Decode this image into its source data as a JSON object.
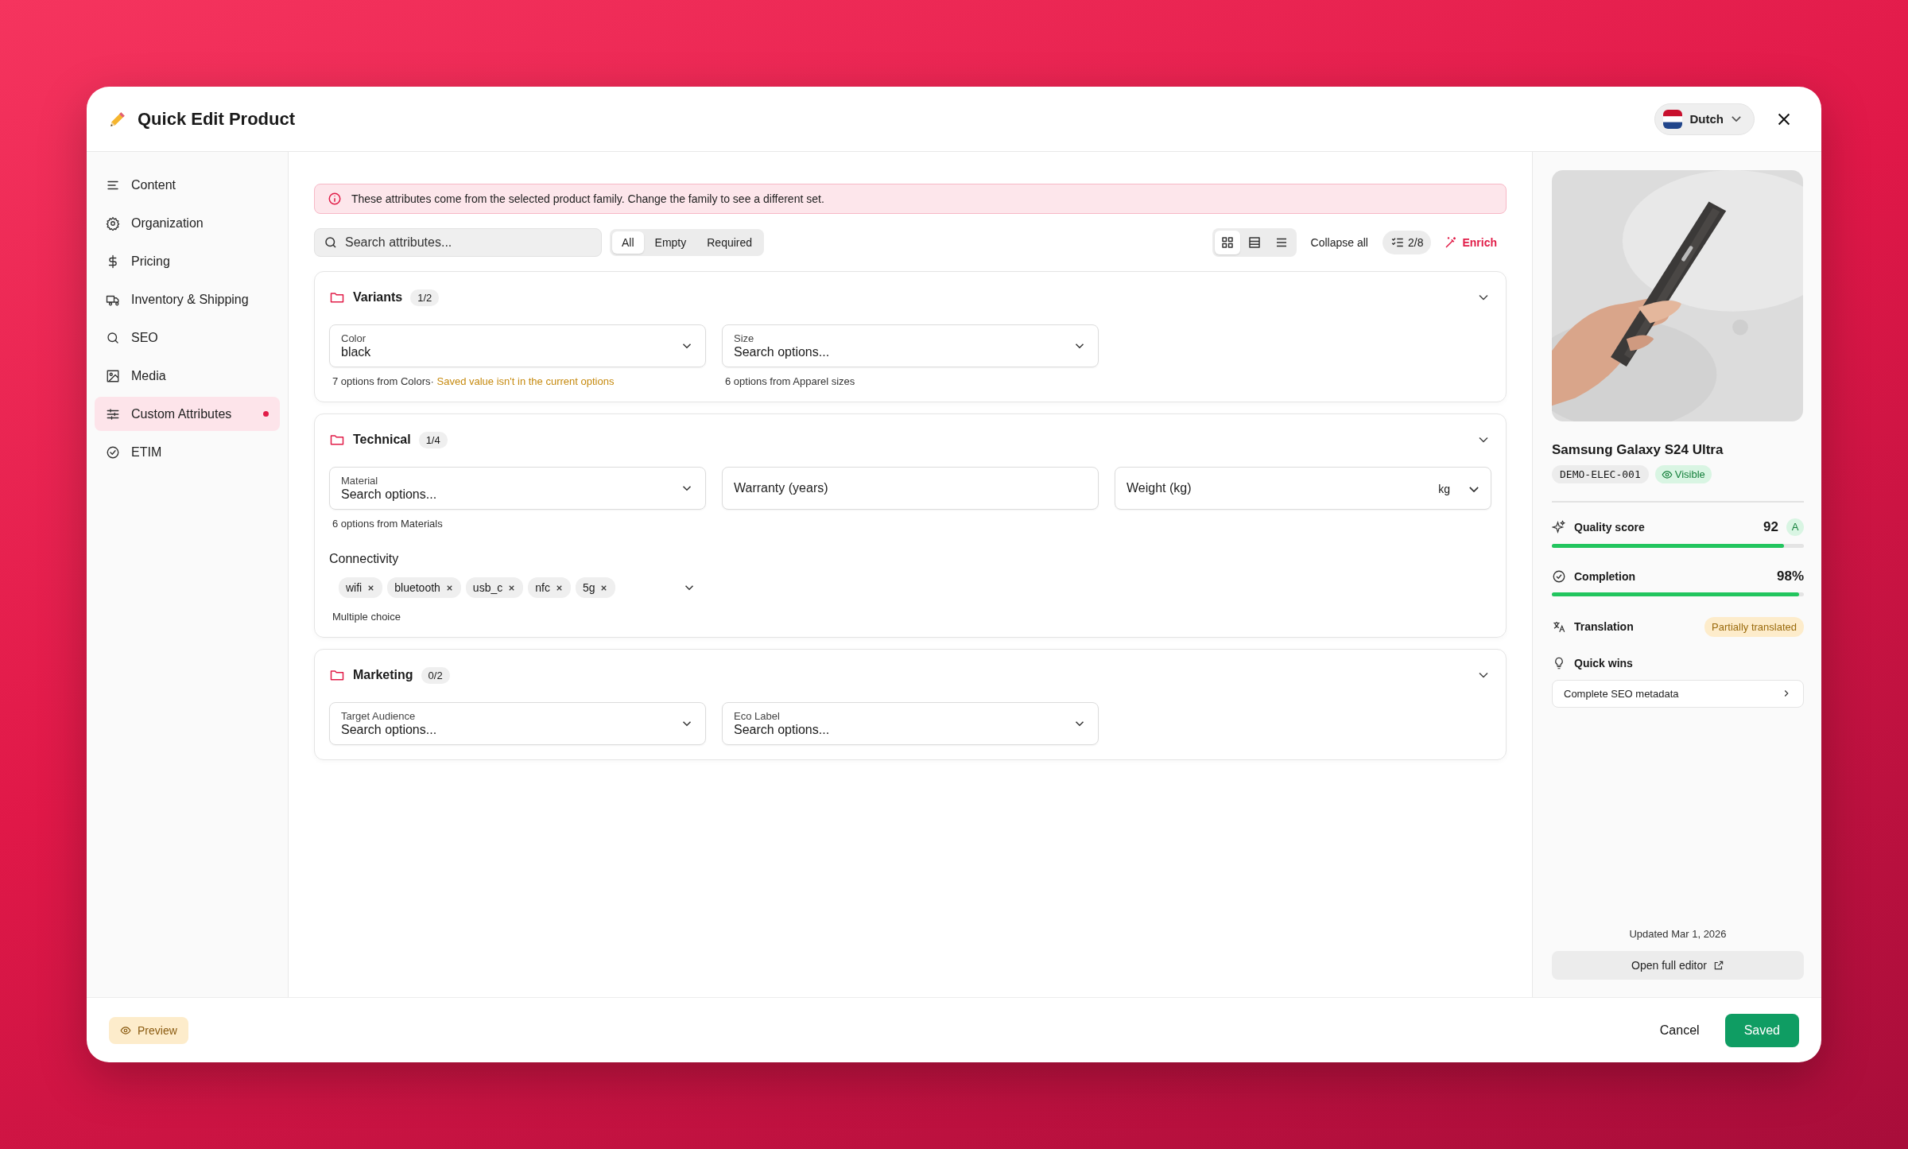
{
  "window": {
    "title": "Quick Edit Product",
    "language": "Dutch"
  },
  "sidebar": {
    "items": [
      {
        "label": "Content",
        "selected": false,
        "unsaved": false
      },
      {
        "label": "Organization",
        "selected": false,
        "unsaved": false
      },
      {
        "label": "Pricing",
        "selected": false,
        "unsaved": false
      },
      {
        "label": "Inventory & Shipping",
        "selected": false,
        "unsaved": false
      },
      {
        "label": "SEO",
        "selected": false,
        "unsaved": false
      },
      {
        "label": "Media",
        "selected": false,
        "unsaved": false
      },
      {
        "label": "Custom Attributes",
        "selected": true,
        "unsaved": true
      },
      {
        "label": "ETIM",
        "selected": false,
        "unsaved": false
      }
    ]
  },
  "notice": "These attributes come from the selected product family. Change the family to see a different set.",
  "toolbar": {
    "search": {
      "placeholder": "Search attributes..."
    },
    "filters": [
      {
        "label": "All",
        "selected": true
      },
      {
        "label": "Empty",
        "selected": false
      },
      {
        "label": "Required",
        "selected": false
      }
    ],
    "view_modes": [
      {
        "selected": true
      },
      {
        "selected": false
      },
      {
        "selected": false
      }
    ],
    "collapse_all": "Collapse all",
    "progress": "2/8",
    "enrich": "Enrich"
  },
  "groups": [
    {
      "name": "Variants",
      "count": "1/2",
      "expanded": true,
      "fields": [
        {
          "kind": "select",
          "label": "Color",
          "value": "black",
          "hint": "7 options from Colors",
          "separator": "·",
          "warning": "Saved value isn't in the current options"
        },
        {
          "kind": "select",
          "label": "Size",
          "placeholder": "Search options...",
          "hint": "6 options from Apparel sizes"
        }
      ]
    },
    {
      "name": "Technical",
      "count": "1/4",
      "expanded": true,
      "fields": [
        {
          "kind": "select",
          "label": "Material",
          "placeholder": "Search options...",
          "hint": "6 options from Materials"
        },
        {
          "kind": "text",
          "placeholder": "Warranty (years)"
        },
        {
          "kind": "unit",
          "placeholder": "Weight (kg)",
          "unit": "kg"
        },
        {
          "kind": "multi",
          "label": "Connectivity",
          "tags": [
            "wifi",
            "bluetooth",
            "usb_c",
            "nfc",
            "5g"
          ],
          "hint": "Multiple choice"
        }
      ]
    },
    {
      "name": "Marketing",
      "count": "0/2",
      "expanded": true,
      "fields": [
        {
          "kind": "select",
          "label": "Target Audience",
          "placeholder": "Search options..."
        },
        {
          "kind": "select",
          "label": "Eco Label",
          "placeholder": "Search options..."
        }
      ]
    }
  ],
  "product": {
    "name": "Samsung Galaxy S24 Ultra",
    "sku": "DEMO-ELEC-001",
    "status": "Visible",
    "quality": {
      "label": "Quality score",
      "value": "92",
      "grade": "A",
      "level": 0.92
    },
    "completion": {
      "label": "Completion",
      "value": "98%",
      "level": 0.98
    },
    "translation": {
      "label": "Translation",
      "status": "Partially translated"
    },
    "quick_wins": {
      "label": "Quick wins",
      "items": [
        "Complete SEO metadata"
      ]
    },
    "updated": "Updated Mar 1, 2026",
    "open_editor": "Open full editor"
  },
  "footer": {
    "preview": "Preview",
    "cancel": "Cancel",
    "save": "Saved"
  }
}
